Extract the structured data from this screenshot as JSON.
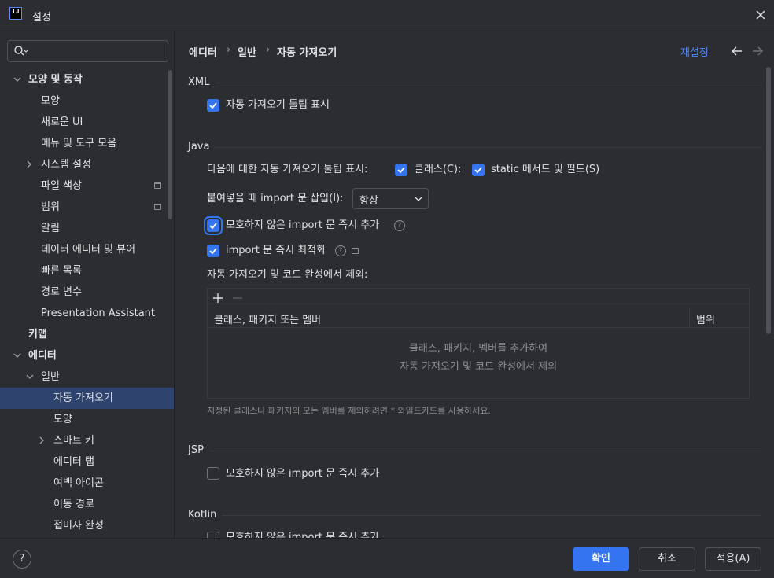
{
  "window": {
    "title": "설정",
    "logo": "IJ"
  },
  "sidebar": {
    "search_placeholder": "",
    "items": [
      {
        "label": "모양 및 동작",
        "expanded": true
      },
      {
        "label": "모양"
      },
      {
        "label": "새로운 UI"
      },
      {
        "label": "메뉴 및 도구 모음"
      },
      {
        "label": "시스템 설정",
        "expandable": true
      },
      {
        "label": "파일 색상"
      },
      {
        "label": "범위"
      },
      {
        "label": "알림"
      },
      {
        "label": "데이터 에디터 및 뷰어"
      },
      {
        "label": "빠른 목록"
      },
      {
        "label": "경로 변수"
      },
      {
        "label": "Presentation Assistant"
      },
      {
        "label": "키맵"
      },
      {
        "label": "에디터",
        "expanded": true
      },
      {
        "label": "일반",
        "expanded": true
      },
      {
        "label": "자동 가져오기",
        "selected": true
      },
      {
        "label": "모양"
      },
      {
        "label": "스마트 키",
        "expandable": true
      },
      {
        "label": "에디터 탭"
      },
      {
        "label": "여백 아이콘"
      },
      {
        "label": "이동 경로"
      },
      {
        "label": "접미사 완성"
      }
    ]
  },
  "breadcrumb": {
    "part1": "에디터",
    "part2": "일반",
    "part3": "자동 가져오기",
    "sep": "›"
  },
  "header": {
    "reset": "재설정"
  },
  "xml": {
    "title": "XML",
    "show_tooltip": {
      "label": "자동 가져오기 툴팁 표시",
      "checked": true
    }
  },
  "java": {
    "title": "Java",
    "tooltip_row_label": "다음에 대한 자동 가져오기 툴팁 표시:",
    "classes": {
      "label": "클래스(C):",
      "checked": true
    },
    "static": {
      "label": "static 메서드 및 필드(S)",
      "checked": true
    },
    "insert_label": "붙여넣을 때 import 문 삽입(I):",
    "insert_value": "항상",
    "add_unambiguous": {
      "label": "모호하지 않은 import 문 즉시 추가",
      "checked": true
    },
    "optimize": {
      "label": "import 문 즉시 최적화",
      "checked": true
    },
    "exclude_label": "자동 가져오기 및 코드 완성에서 제외:",
    "table": {
      "col_member": "클래스, 패키지 또는 멤버",
      "col_scope": "범위",
      "empty_line1": "클래스, 패키지, 멤버를 추가하여",
      "empty_line2": "자동 가져오기 및 코드 완성에서 제외"
    },
    "hint": "지정된 클래스나 패키지의 모든 멤버를 제외하려면 * 와일드카드를 사용하세요."
  },
  "jsp": {
    "title": "JSP",
    "add_unambiguous": {
      "label": "모호하지 않은 import 문 즉시 추가",
      "checked": false
    }
  },
  "kotlin": {
    "title": "Kotlin",
    "add_unambiguous": {
      "label": "모호하지 않은 import 문 즉시 추가",
      "checked": false
    }
  },
  "footer": {
    "help": "?",
    "ok": "확인",
    "cancel": "취소",
    "apply": "적용(A)"
  },
  "colors": {
    "accent": "#3574f0",
    "link": "#548af7",
    "selected": "#2e436e",
    "background": "#2b2d30"
  }
}
